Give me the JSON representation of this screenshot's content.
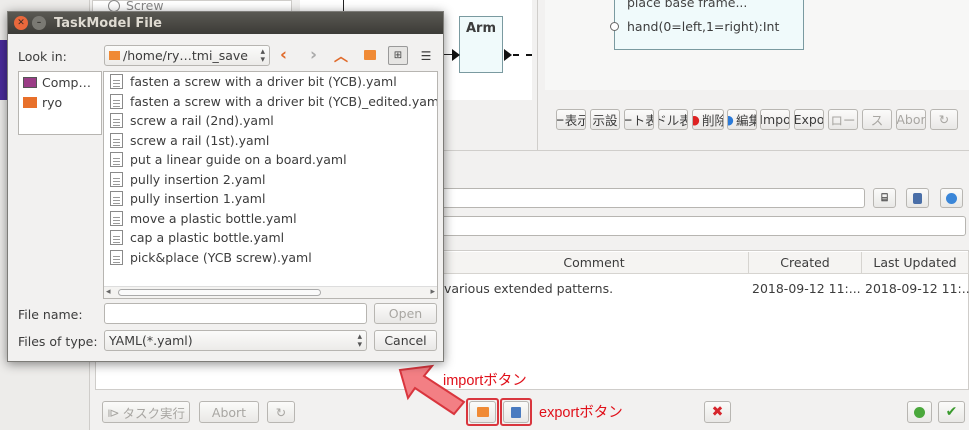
{
  "dialog": {
    "title": "TaskModel File",
    "look_in_label": "Look in:",
    "path": "/home/ry…tmi_save",
    "places": [
      "Comp…",
      "ryo"
    ],
    "files": [
      "fasten a screw with a driver bit (YCB).yaml",
      "fasten a screw with a driver bit (YCB)_edited.yaml",
      "screw a rail (2nd).yaml",
      "screw a rail (1st).yaml",
      "put a linear guide on a board.yaml",
      "pully insertion 2.yaml",
      "pully insertion 1.yaml",
      "move a plastic bottle.yaml",
      "cap a plastic bottle.yaml",
      "pick&place (YCB screw).yaml"
    ],
    "file_name_label": "File name:",
    "file_name_value": "",
    "files_of_type_label": "Files of type:",
    "files_of_type_value": "YAML(*.yaml)",
    "open_button": "Open",
    "cancel_button": "Cancel"
  },
  "background": {
    "screw_item": "Screw",
    "arm_node": "Arm",
    "node_line1": "place base frame...",
    "node_line2": "hand(0=left,1=right):Int",
    "toolbar_buttons": [
      "ー表示",
      "示設",
      "ート表",
      "ドル表",
      "削除",
      "編集",
      "Impo",
      "Expo",
      "ロー",
      "ス",
      "Abor"
    ],
    "table_headers": [
      "Comment",
      "Created",
      "Last Updated"
    ],
    "table_row": {
      "comment": "various extended patterns.",
      "created": "2018-09-12 11:...",
      "updated": "2018-09-12 11:..."
    },
    "bottom_run_button": "タスク実行",
    "bottom_abort_button": "Abort"
  },
  "annotations": {
    "import_label": "importボタン",
    "export_label": "exportボタン"
  }
}
